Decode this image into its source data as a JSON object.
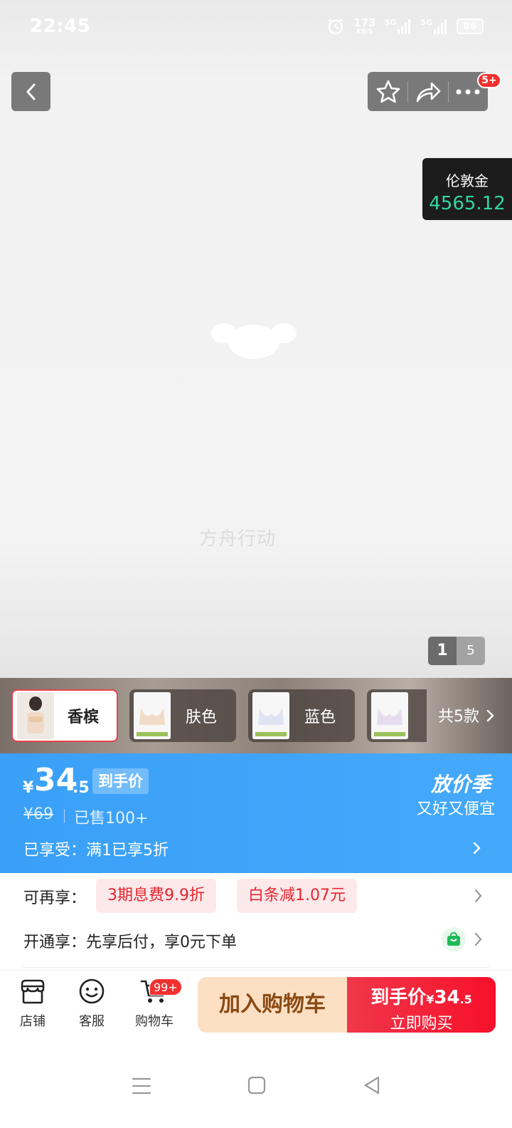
{
  "status_bar": {
    "time": "22:45",
    "net_speed_value": "173",
    "net_speed_unit": "KB/S",
    "sig1": "5G",
    "sig2": "5G",
    "battery": "86"
  },
  "header": {
    "notification_badge": "5+"
  },
  "gold_widget": {
    "label": "伦敦金",
    "value": "4565.12"
  },
  "hero": {
    "watermark": "方舟行动",
    "page_current": "1",
    "page_total": "5"
  },
  "variants": {
    "items": [
      {
        "label": "香槟",
        "selected": true
      },
      {
        "label": "肤色",
        "selected": false
      },
      {
        "label": "蓝色",
        "selected": false
      },
      {
        "label": "",
        "selected": false
      }
    ],
    "count_label": "共5款"
  },
  "price": {
    "currency": "¥",
    "integer": "34",
    "decimal": ".5",
    "tag": "到手价",
    "original": "¥69",
    "sold": "已售100+",
    "promo_title": "放价季",
    "promo_subtitle": "又好又便宜",
    "enjoyed": "已享受：满1已享5折"
  },
  "benefits": {
    "more_label": "可再享：",
    "coupon1": "3期息费9.9折",
    "coupon2": "白条减1.07元",
    "open_label": "开通享：先享后付，享0元下单"
  },
  "bottom_bar": {
    "store": "店铺",
    "service": "客服",
    "cart": "购物车",
    "cart_badge": "99+",
    "add_to_cart": "加入购物车",
    "buy_price_prefix": "到手价",
    "buy_currency": "¥",
    "buy_price_int": "34",
    "buy_price_dec": ".5",
    "buy_now": "立即购买"
  },
  "colors": {
    "accent_blue": "#3aa0f7",
    "buy_red": "#f7102a",
    "add_cart_bg": "#fde0c4",
    "coupon_red": "#e3262e",
    "gold_green": "#33d6a3"
  }
}
